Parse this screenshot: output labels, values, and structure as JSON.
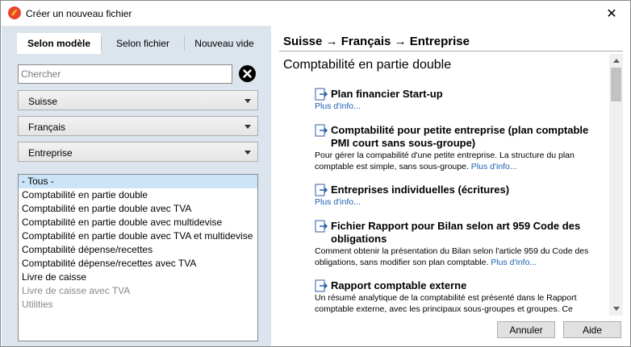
{
  "window": {
    "title": "Créer un nouveau fichier",
    "app_icon": "banana-app-icon",
    "close_glyph": "✕"
  },
  "tabs": [
    {
      "label": "Selon modèle",
      "active": true
    },
    {
      "label": "Selon fichier",
      "active": false
    },
    {
      "label": "Nouveau vide",
      "active": false
    }
  ],
  "search": {
    "placeholder": "Chercher",
    "value": ""
  },
  "filters": {
    "country": "Suisse",
    "language": "Français",
    "category": "Entreprise"
  },
  "categories_list": [
    {
      "label": "- Tous -",
      "selected": true,
      "disabled": false
    },
    {
      "label": "Comptabilité en partie double",
      "selected": false,
      "disabled": false
    },
    {
      "label": "Comptabilité en partie double avec TVA",
      "selected": false,
      "disabled": false
    },
    {
      "label": "Comptabilité en partie double avec multidevise",
      "selected": false,
      "disabled": false
    },
    {
      "label": "Comptabilité en partie double avec TVA et multidevise",
      "selected": false,
      "disabled": false
    },
    {
      "label": "Comptabilité dépense/recettes",
      "selected": false,
      "disabled": false
    },
    {
      "label": "Comptabilité dépense/recettes avec TVA",
      "selected": false,
      "disabled": false
    },
    {
      "label": "Livre de caisse",
      "selected": false,
      "disabled": false
    },
    {
      "label": "Livre de caisse avec TVA",
      "selected": false,
      "disabled": true
    },
    {
      "label": "Utilities",
      "selected": false,
      "disabled": true
    }
  ],
  "right": {
    "breadcrumb": "Suisse → Français → Entreprise",
    "section_title": "Comptabilité en partie double",
    "more_link": "Plus d'info...",
    "items": [
      {
        "title": "Plan financier Start-up",
        "description": ""
      },
      {
        "title": "Comptabilité pour petite entreprise (plan comptable PMI court sans sous-groupe)",
        "description": "Pour gérer la compabilité d'une petite entreprise. La structure du plan comptable est simple, sans sous-groupe."
      },
      {
        "title": "Entreprises individuelles (écritures)",
        "description": ""
      },
      {
        "title": "Fichier Rapport pour Bilan selon art 959 Code des obligations",
        "description": "Comment obtenir la présentation du Bilan selon l'article 959 du Code des obligations, sans modifier son plan comptable."
      },
      {
        "title": "Rapport comptable externe",
        "description": "Un résumé analytique de la comptabilité est présenté dans le Rapport comptable externe, avec les principaux sous-groupes et groupes. Ce"
      }
    ]
  },
  "buttons": {
    "cancel": "Annuler",
    "help": "Aide"
  }
}
